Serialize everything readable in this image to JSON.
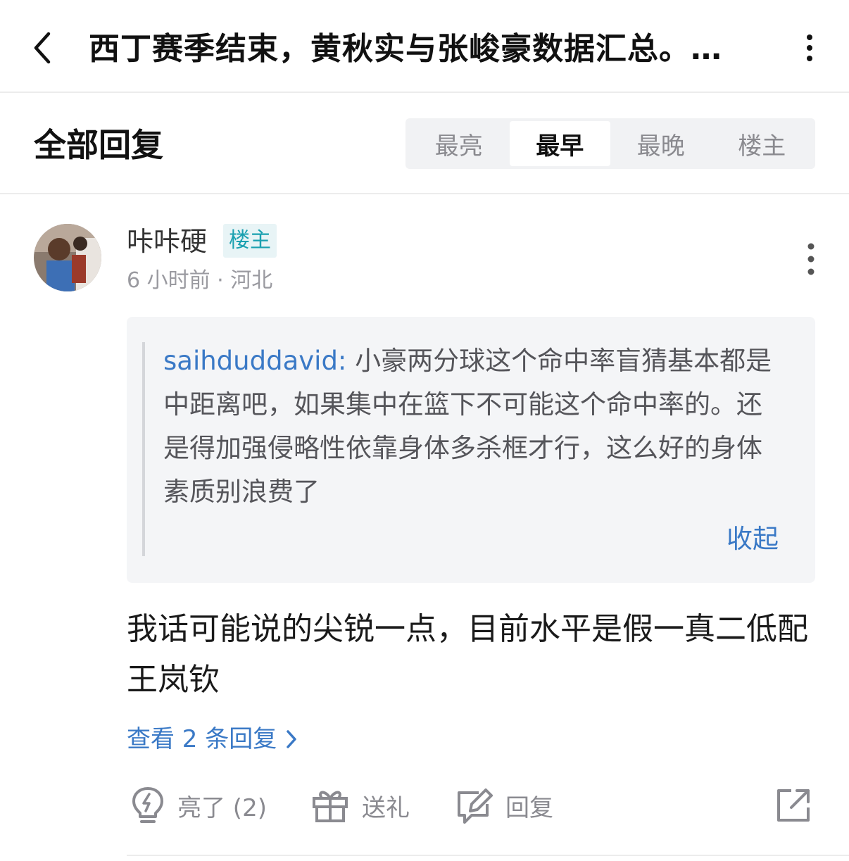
{
  "header": {
    "title": "西丁赛季结束，黄秋实与张峻豪数据汇总。…"
  },
  "replies_section": {
    "title": "全部回复",
    "tabs": [
      {
        "label": "最亮",
        "active": false
      },
      {
        "label": "最早",
        "active": true
      },
      {
        "label": "最晚",
        "active": false
      },
      {
        "label": "楼主",
        "active": false
      }
    ]
  },
  "post": {
    "username": "咔咔硬",
    "op_badge": "楼主",
    "meta": "6 小时前 · 河北",
    "quote": {
      "user": "saihduddavid:",
      "text": " 小豪两分球这个命中率盲猜基本都是中距离吧，如果集中在篮下不可能这个命中率的。还是得加强侵略性依靠身体多杀框才行，这么好的身体素质别浪费了",
      "collapse_label": "收起"
    },
    "body": "我话可能说的尖锐一点，目前水平是假一真二低配王岚钦",
    "view_replies": "查看 2 条回复",
    "actions": {
      "like": "亮了 (2)",
      "gift": "送礼",
      "reply": "回复"
    }
  },
  "colors": {
    "link": "#3a79c6",
    "op_badge_text": "#1aa0b0",
    "op_badge_bg": "#e8f4f6",
    "muted": "#8a8a90"
  },
  "icons": [
    "back-icon",
    "more-vertical-icon",
    "lightbulb-icon",
    "gift-icon",
    "edit-reply-icon",
    "share-icon",
    "chevron-right-icon"
  ]
}
